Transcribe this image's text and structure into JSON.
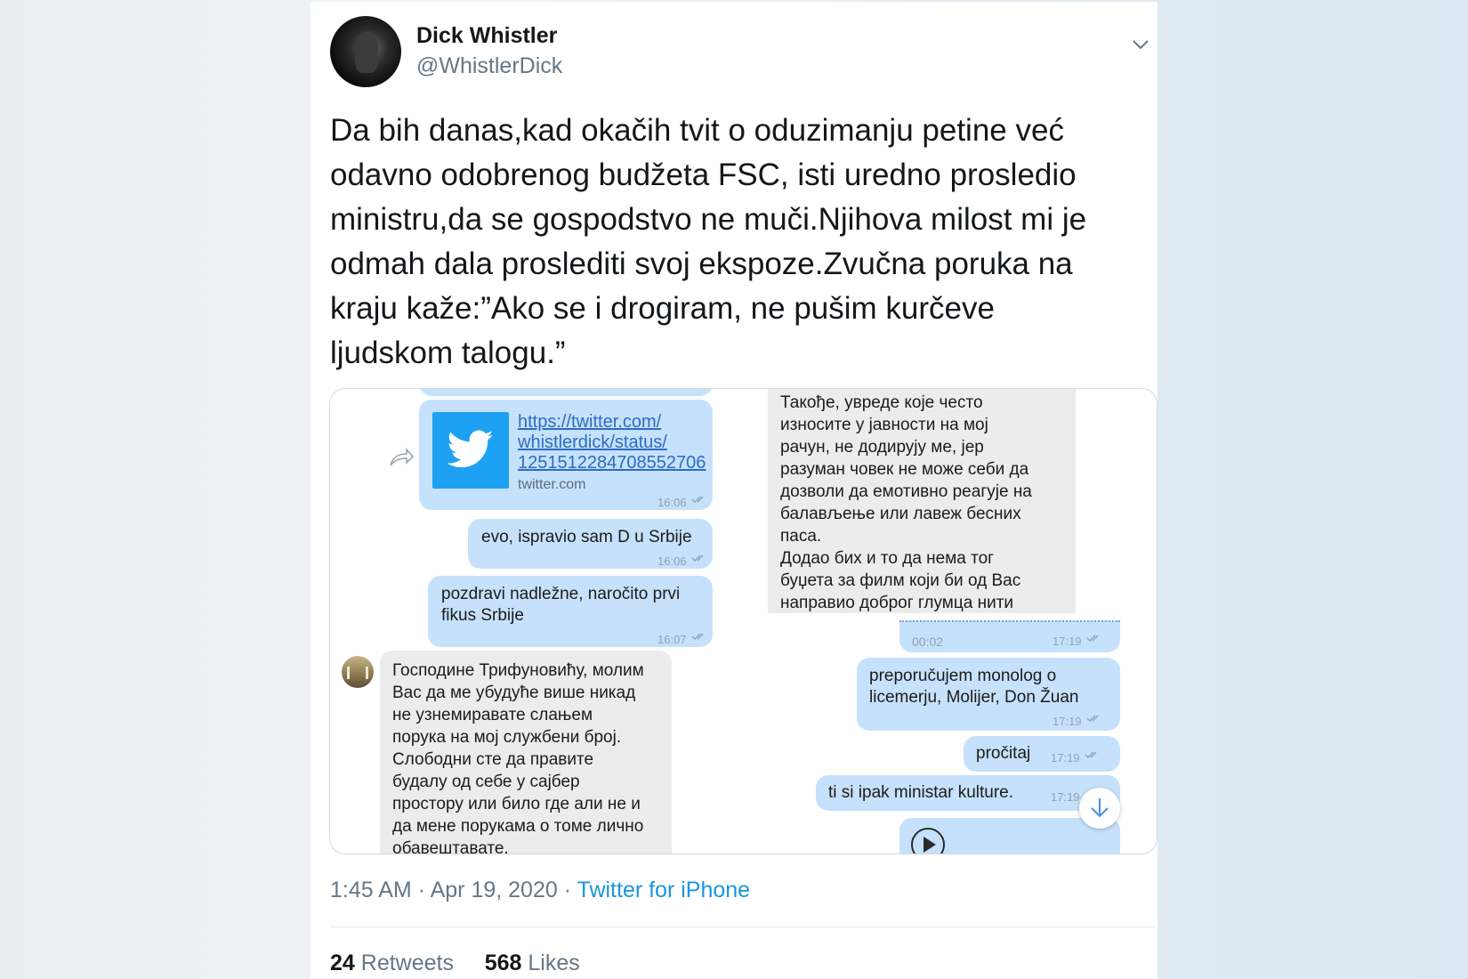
{
  "tweet": {
    "display_name": "Dick Whistler",
    "handle": "@WhistlerDick",
    "text_lines": [
      "Da bih danas,kad okačih tvit  o oduzimanju petine već",
      "odavno odobrenog budžeta FSC, isti uredno prosledio",
      "ministru,da se gospodstvo ne muči.Njihova milost mi je",
      "odmah dala proslediti svoj ekspoze.Zvučna poruka na",
      "kraju kaže:”Ako se i drogiram, ne pušim kurčeve",
      "ljudskom talogu.”"
    ],
    "time": "1:45 AM",
    "date": "Apr 19, 2020",
    "separator": "·",
    "source": "Twitter for iPhone",
    "retweets_count": "24",
    "retweets_label": "Retweets",
    "likes_count": "568",
    "likes_label": "Likes"
  },
  "chat_left": {
    "link_card": {
      "url_lines": [
        "https://twitter.com/",
        "whistlerdick/status/",
        "1251512284708552706"
      ],
      "domain": "twitter.com",
      "time": "16:06"
    },
    "messages_out": [
      {
        "text_lines": [
          "evo, ispravio sam D u Srbije"
        ],
        "time": "16:06"
      },
      {
        "text_lines": [
          "pozdravi nadležne, naročito prvi",
          "fikus Srbije"
        ],
        "time": "16:07"
      }
    ],
    "message_in": {
      "text_lines": [
        "Господине Трифуновићу, молим",
        "Вас да ме убудуће више никад",
        "не узнемиравате слањем",
        "порука на мој службени број.",
        "Слободни сте да правите",
        "будалу од себе у сајбер",
        "простору или било где али не и",
        "да мене порукама о томе лично",
        "обавештавате."
      ]
    }
  },
  "chat_right": {
    "message_in": {
      "text_lines": [
        "Такође, увреде које често",
        "износите у јавности на мој",
        "рачун, не додирују ме, јер",
        "разуман човек не може себи да",
        "дозволи да емотивно реагује на",
        "балављење или лавеж бесних",
        "паса.",
        "Додао бих и то да нема тог",
        "буџета за филм који би од Вас",
        "направио доброг глумца нити"
      ]
    },
    "voice_message": {
      "duration": "00:02",
      "time": "17:19"
    },
    "messages_out": [
      {
        "text_lines": [
          "preporučujem monolog o",
          "licemerju, Molijer, Don Žuan"
        ],
        "time": "17:19"
      },
      {
        "text_lines": [
          "pročitaj"
        ],
        "time": "17:19"
      },
      {
        "text_lines": [
          "ti si ipak ministar kulture."
        ],
        "time": "17:19"
      }
    ]
  },
  "colors": {
    "twitter_blue": "#1da1f2",
    "link_blue": "#1b95e0",
    "bubble_out": "#c6e1fb",
    "bubble_in": "#ececec",
    "text_primary": "#14171a",
    "text_secondary": "#657786"
  },
  "icons": [
    "chevron-down-icon",
    "forward-share-icon",
    "twitter-bird-icon",
    "double-check-icon",
    "scroll-down-arrow-icon",
    "play-icon"
  ]
}
